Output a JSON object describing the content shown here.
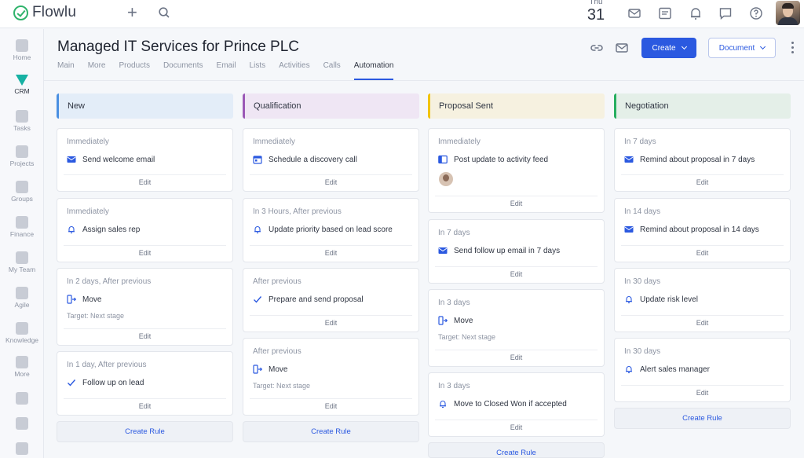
{
  "app": {
    "name": "Flowlu",
    "brand_color": "#2fb36b",
    "accent_color": "#2b59e0"
  },
  "topbar": {
    "date_dow": "Thu",
    "date_day": "31",
    "icons": [
      "plus-icon",
      "search-icon",
      "mail-icon",
      "notes-icon",
      "bell-icon",
      "chat-icon",
      "help-icon"
    ]
  },
  "sidebar": {
    "items": [
      {
        "label": "Home",
        "icon": "home-icon"
      },
      {
        "label": "CRM",
        "icon": "crm-icon",
        "active": true
      },
      {
        "label": "Tasks",
        "icon": "tasks-icon"
      },
      {
        "label": "Projects",
        "icon": "projects-icon"
      },
      {
        "label": "Groups",
        "icon": "groups-icon"
      },
      {
        "label": "Finance",
        "icon": "finance-icon"
      },
      {
        "label": "My Team",
        "icon": "team-icon"
      },
      {
        "label": "Agile",
        "icon": "agile-icon"
      },
      {
        "label": "Knowledge",
        "icon": "knowledge-icon"
      },
      {
        "label": "More",
        "icon": "grid-icon"
      }
    ]
  },
  "header": {
    "title": "Managed IT Services for Prince PLC",
    "tabs": [
      "Main",
      "More",
      "Products",
      "Documents",
      "Email",
      "Lists",
      "Activities",
      "Calls",
      "Automation"
    ],
    "active_tab": "Automation",
    "create_label": "Create",
    "document_label": "Document"
  },
  "board": {
    "edit_label": "Edit",
    "create_rule_label": "Create Rule",
    "columns": [
      {
        "name": "New",
        "color": "#4a90e2",
        "bg": "#e3edf8",
        "cards": [
          {
            "timing": "Immediately",
            "action": "Send welcome email",
            "icon": "mail-icon"
          },
          {
            "timing": "Immediately",
            "action": "Assign sales rep",
            "icon": "bell-icon"
          },
          {
            "timing": "In 2 days, After previous",
            "action": "Move",
            "icon": "move-icon",
            "target": "Target: Next stage"
          },
          {
            "timing": "In 1 day, After previous",
            "action": "Follow up on lead",
            "icon": "check-icon"
          }
        ]
      },
      {
        "name": "Qualification",
        "color": "#9b59b6",
        "bg": "#efe6f4",
        "cards": [
          {
            "timing": "Immediately",
            "action": "Schedule a discovery call",
            "icon": "calendar-icon"
          },
          {
            "timing": "In 3 Hours, After previous",
            "action": "Update priority based on lead score",
            "icon": "bell-icon"
          },
          {
            "timing": "After previous",
            "action": "Prepare and send proposal",
            "icon": "check-icon"
          },
          {
            "timing": "After previous",
            "action": "Move",
            "icon": "move-icon",
            "target": "Target: Next stage"
          }
        ]
      },
      {
        "name": "Proposal Sent",
        "color": "#f1c40f",
        "bg": "#f6f1e0",
        "cards": [
          {
            "timing": "Immediately",
            "action": "Post update to activity feed",
            "icon": "feed-icon",
            "avatar": true
          },
          {
            "timing": "In 7 days",
            "action": "Send follow up email in 7 days",
            "icon": "mail-icon"
          },
          {
            "timing": "In 3 days",
            "action": "Move",
            "icon": "move-icon",
            "target": "Target: Next stage"
          },
          {
            "timing": "In 3 days",
            "action": "Move to Closed Won if accepted",
            "icon": "bell-icon"
          }
        ]
      },
      {
        "name": "Negotiation",
        "color": "#27ae60",
        "bg": "#e4efe8",
        "cards": [
          {
            "timing": "In 7 days",
            "action": "Remind about proposal in 7 days",
            "icon": "mail-icon"
          },
          {
            "timing": "In 14 days",
            "action": "Remind about proposal in 14 days",
            "icon": "mail-icon"
          },
          {
            "timing": "In 30 days",
            "action": "Update risk level",
            "icon": "bell-icon"
          },
          {
            "timing": "In 30 days",
            "action": "Alert sales manager",
            "icon": "bell-icon"
          }
        ]
      }
    ]
  }
}
